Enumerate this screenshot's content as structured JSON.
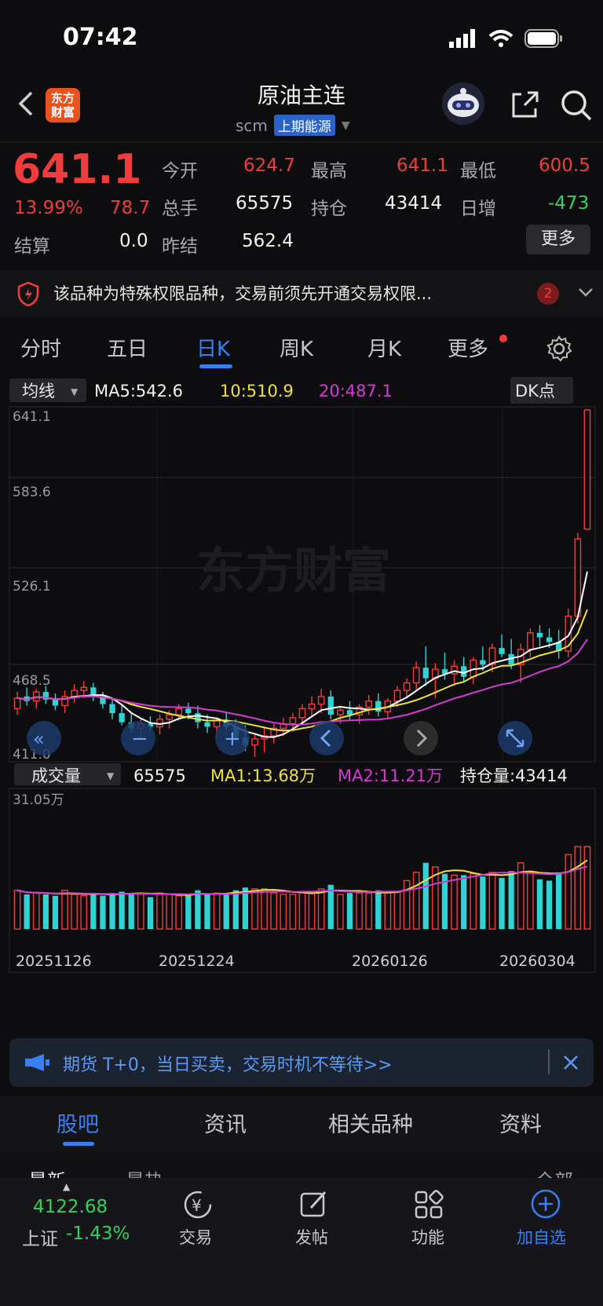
{
  "status": {
    "time": "07:42"
  },
  "header": {
    "logo_line1": "东方",
    "logo_line2": "财富",
    "title": "原油主连",
    "code": "scm",
    "exchange": "上期能源"
  },
  "quote": {
    "price": "641.1",
    "pct": "13.99%",
    "change": "78.7",
    "open_label": "今开",
    "open": "624.7",
    "high_label": "最高",
    "high": "641.1",
    "low_label": "最低",
    "low": "600.5",
    "vol_label": "总手",
    "vol": "65575",
    "oi_label": "持仓",
    "oi": "43414",
    "oichg_label": "日增",
    "oichg": "-473",
    "settle_label": "结算",
    "settle": "0.0",
    "prev_label": "昨结",
    "prev": "562.4",
    "more_label": "更多"
  },
  "notice": {
    "text": "该品种为特殊权限品种，交易前须先开通交易权限...",
    "count": "2"
  },
  "tabs": [
    "分时",
    "五日",
    "日K",
    "周K",
    "月K",
    "更多"
  ],
  "ma_bar": {
    "selector": "均线",
    "ma5": "MA5:542.6",
    "ma10": "10:510.9",
    "ma20": "20:487.1",
    "dk": "DK点"
  },
  "price_axis": [
    "641.1",
    "583.6",
    "526.1",
    "468.5",
    "411.0"
  ],
  "watermark": "东方财富",
  "vol_bar": {
    "selector": "成交量",
    "vol": "65575",
    "ma1": "MA1:13.68万",
    "ma2": "MA2:11.21万",
    "oi": "持仓量:43414",
    "axis_max": "31.05万"
  },
  "dates": [
    "20251126",
    "20251224",
    "20260126",
    "20260304"
  ],
  "promo": {
    "text": "期货 T+0，当日买卖，交易时机不等待>>"
  },
  "bottom_tabs": [
    "股吧",
    "资讯",
    "相关品种",
    "资料"
  ],
  "bottom_tabs_peek": [
    "最新",
    "最热",
    "全部"
  ],
  "nav": {
    "index_value": "4122.68",
    "index_name": "上证",
    "index_pct": "-1.43%",
    "items": [
      "交易",
      "发帖",
      "功能",
      "加自选"
    ]
  },
  "colors": {
    "up": "#f23c3c",
    "down": "#2fd3d3",
    "ma5": "#ffffff",
    "ma10": "#f0e040",
    "ma20": "#d23cd2",
    "accent": "#3a7ff0"
  },
  "chart_data": {
    "type": "candlestick",
    "ylim": [
      411.0,
      641.1
    ],
    "candles": [
      [
        444,
        455,
        440,
        451
      ],
      [
        452,
        458,
        446,
        449
      ],
      [
        449,
        457,
        444,
        455
      ],
      [
        455,
        459,
        447,
        450
      ],
      [
        450,
        454,
        443,
        446
      ],
      [
        446,
        456,
        441,
        452
      ],
      [
        452,
        460,
        448,
        456
      ],
      [
        456,
        462,
        451,
        458
      ],
      [
        458,
        461,
        449,
        452
      ],
      [
        452,
        455,
        444,
        447
      ],
      [
        447,
        450,
        437,
        441
      ],
      [
        441,
        447,
        433,
        435
      ],
      [
        435,
        441,
        428,
        431
      ],
      [
        431,
        437,
        424,
        434
      ],
      [
        434,
        439,
        429,
        432
      ],
      [
        432,
        440,
        427,
        437
      ],
      [
        437,
        443,
        431,
        440
      ],
      [
        440,
        447,
        436,
        444
      ],
      [
        444,
        448,
        437,
        441
      ],
      [
        441,
        446,
        431,
        435
      ],
      [
        435,
        440,
        428,
        432
      ],
      [
        432,
        438,
        425,
        436
      ],
      [
        436,
        442,
        430,
        432
      ],
      [
        432,
        437,
        422,
        425
      ],
      [
        425,
        433,
        416,
        420
      ],
      [
        420,
        428,
        412,
        424
      ],
      [
        424,
        431,
        415,
        426
      ],
      [
        426,
        434,
        421,
        431
      ],
      [
        431,
        438,
        426,
        434
      ],
      [
        434,
        441,
        429,
        438
      ],
      [
        438,
        447,
        433,
        444
      ],
      [
        444,
        452,
        439,
        447
      ],
      [
        447,
        457,
        441,
        452
      ],
      [
        452,
        456,
        437,
        440
      ],
      [
        440,
        446,
        434,
        443
      ],
      [
        443,
        449,
        436,
        440
      ],
      [
        440,
        447,
        434,
        445
      ],
      [
        445,
        453,
        440,
        449
      ],
      [
        449,
        454,
        439,
        442
      ],
      [
        442,
        451,
        438,
        449
      ],
      [
        449,
        459,
        445,
        456
      ],
      [
        456,
        464,
        451,
        461
      ],
      [
        461,
        475,
        456,
        471
      ],
      [
        471,
        485,
        459,
        464
      ],
      [
        464,
        474,
        451,
        470
      ],
      [
        470,
        481,
        463,
        467
      ],
      [
        467,
        476,
        459,
        472
      ],
      [
        472,
        478,
        461,
        465
      ],
      [
        465,
        478,
        460,
        476
      ],
      [
        476,
        485,
        469,
        473
      ],
      [
        473,
        487,
        468,
        484
      ],
      [
        484,
        493,
        478,
        480
      ],
      [
        480,
        490,
        470,
        473
      ],
      [
        473,
        487,
        461,
        483
      ],
      [
        483,
        497,
        478,
        494
      ],
      [
        494,
        499,
        485,
        491
      ],
      [
        491,
        497,
        484,
        488
      ],
      [
        488,
        496,
        477,
        482
      ],
      [
        482,
        510,
        478,
        505
      ],
      [
        505,
        560,
        500,
        556
      ],
      [
        562.4,
        641.1,
        600.5,
        641.1
      ]
    ],
    "volume_max": "31.05万"
  }
}
